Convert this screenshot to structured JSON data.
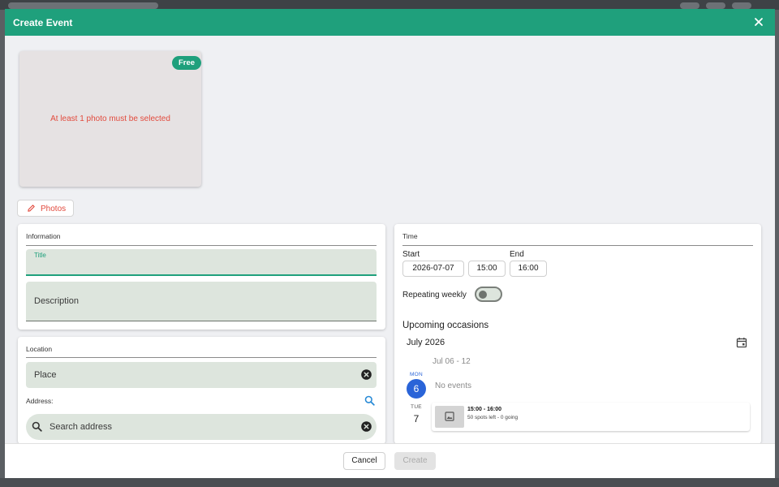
{
  "dialog": {
    "title": "Create Event",
    "close_icon": "close-icon"
  },
  "photo": {
    "badge": "Free",
    "error": "At least 1 photo must be selected",
    "button_label": "Photos",
    "button_icon": "pencil-icon"
  },
  "information": {
    "heading": "Information",
    "title_label": "Title",
    "description_placeholder": "Description"
  },
  "location": {
    "heading": "Location",
    "place_placeholder": "Place",
    "address_label": "Address:",
    "search_placeholder": "Search address"
  },
  "time": {
    "heading": "Time",
    "start_label": "Start",
    "start_date": "2026-07-07",
    "start_time": "15:00",
    "end_label": "End",
    "end_time": "16:00",
    "repeating_label": "Repeating weekly",
    "repeating_on": false
  },
  "occasions": {
    "heading": "Upcoming occasions",
    "month": "July 2026",
    "week_range": "Jul 06 - 12",
    "days": [
      {
        "name": "MON",
        "num": "6",
        "today": true,
        "text": "No events"
      },
      {
        "name": "TUE",
        "num": "7",
        "today": false
      }
    ],
    "event": {
      "time": "15:00 - 16:00",
      "info": "50 spots left - 0 going"
    }
  },
  "footer": {
    "cancel": "Cancel",
    "create": "Create"
  },
  "colors": {
    "primary": "#1fa07c",
    "error": "#e24a3d",
    "today": "#2a64d8",
    "field_bg": "#dde5dd"
  }
}
